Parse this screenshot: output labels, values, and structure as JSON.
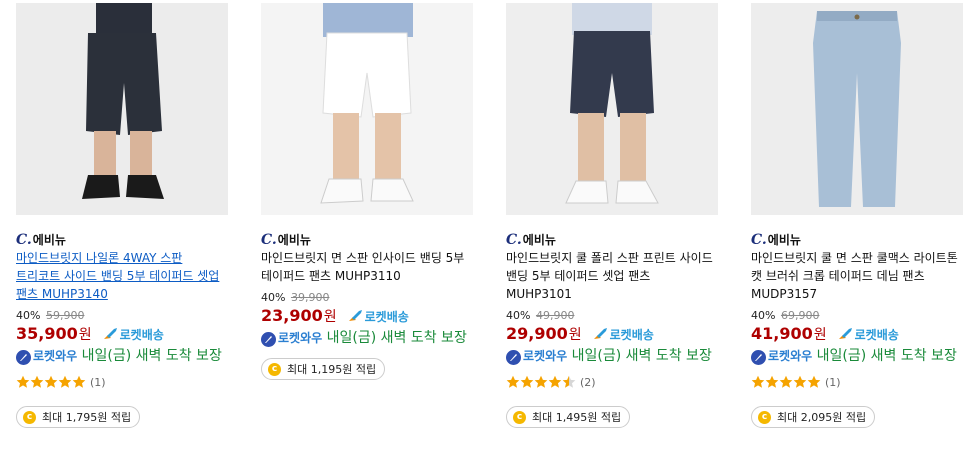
{
  "products": [
    {
      "brand": "에비뉴",
      "brand_mark": "C.",
      "title": "마인드브릿지 나일론 4WAY 스판 트리코트 사이드 밴딩 5부 테이퍼드 셋업 팬츠 MUHP3140",
      "discount": "40%",
      "original_price": "59,900",
      "price": "35,900",
      "currency": "원",
      "rocket": "로켓배송",
      "wow_label": "로켓와우",
      "delivery": "내일(금) 새벽 도착 보장",
      "rating_count": "(1)",
      "rating": 5,
      "reward": "최대 1,795원 적립",
      "coin": "c"
    },
    {
      "brand": "에비뉴",
      "brand_mark": "C.",
      "title": "마인드브릿지 면 스판 인사이드 밴딩 5부 테이퍼드 팬츠 MUHP3110",
      "discount": "40%",
      "original_price": "39,900",
      "price": "23,900",
      "currency": "원",
      "rocket": "로켓배송",
      "wow_label": "로켓와우",
      "delivery": "내일(금) 새벽 도착 보장",
      "reward": "최대 1,195원 적립",
      "coin": "c"
    },
    {
      "brand": "에비뉴",
      "brand_mark": "C.",
      "title": "마인드브릿지 쿨 폴리 스판 프린트 사이드 밴딩 5부 테이퍼드 셋업 팬츠 MUHP3101",
      "discount": "40%",
      "original_price": "49,900",
      "price": "29,900",
      "currency": "원",
      "rocket": "로켓배송",
      "wow_label": "로켓와우",
      "delivery": "내일(금) 새벽 도착 보장",
      "rating_count": "(2)",
      "rating": 4.5,
      "reward": "최대 1,495원 적립",
      "coin": "c"
    },
    {
      "brand": "에비뉴",
      "brand_mark": "C.",
      "title": "마인드브릿지 쿨 면 스판 쿨맥스 라이트톤 캣 브러쉬 크롭 테이퍼드 데님 팬츠 MUDP3157",
      "discount": "40%",
      "original_price": "69,900",
      "price": "41,900",
      "currency": "원",
      "rocket": "로켓배송",
      "wow_label": "로켓와우",
      "delivery": "내일(금) 새벽 도착 보장",
      "rating_count": "(1)",
      "rating": 5,
      "reward": "최대 2,095원 적립",
      "coin": "c"
    }
  ],
  "colors": {
    "price": "#ae0000",
    "rocket": "#2b9bd9",
    "delivery": "#1a8a3a",
    "star": "#f5a300",
    "link": "#0d5cc4"
  }
}
